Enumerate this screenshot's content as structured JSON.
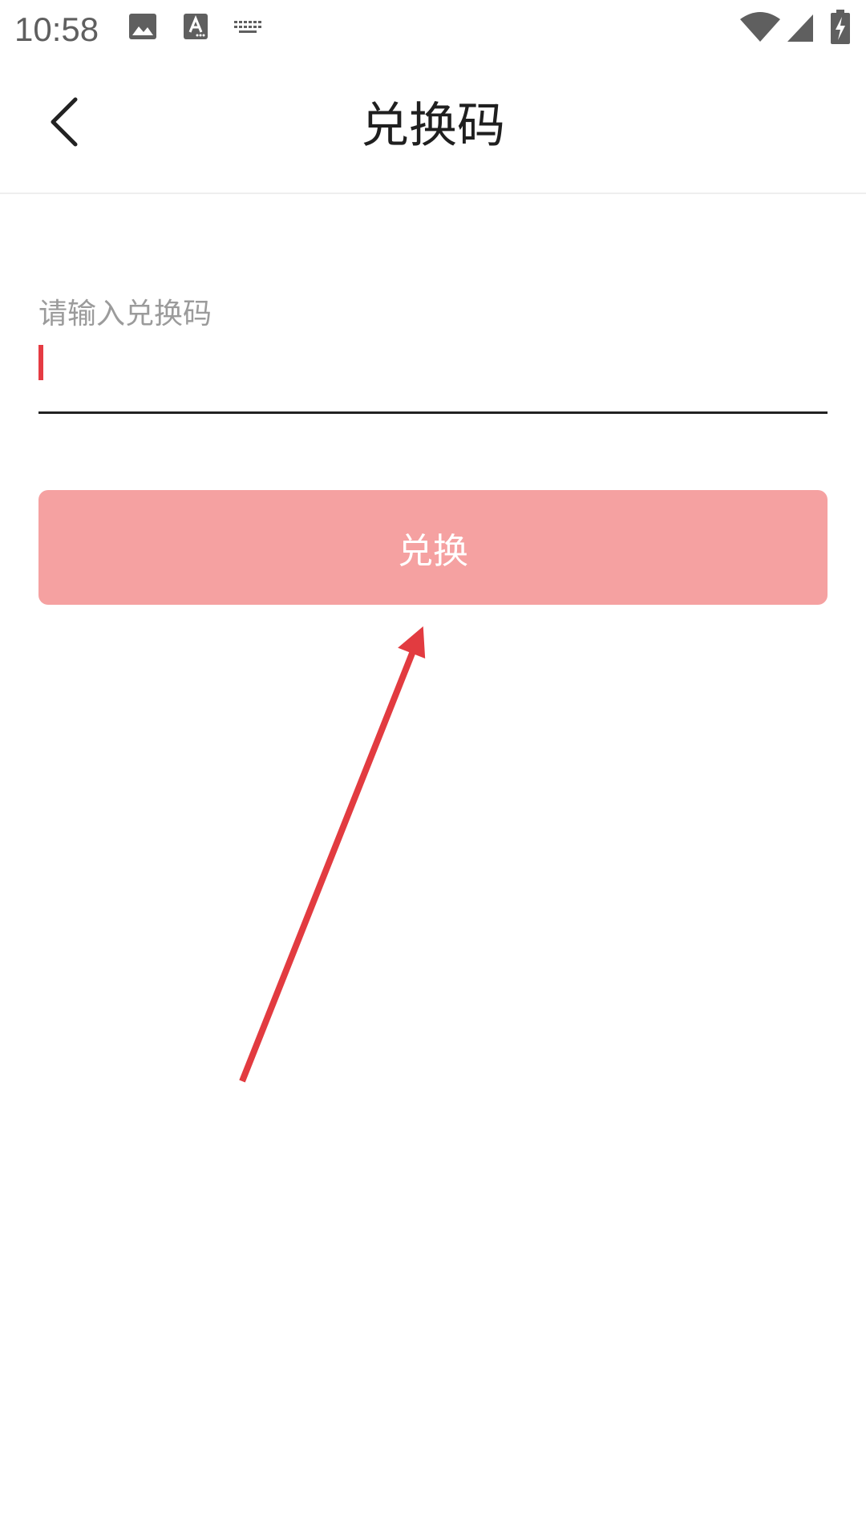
{
  "status_bar": {
    "time": "10:58",
    "icons": [
      "image-notification-icon",
      "a-notification-icon",
      "keyboard-icon",
      "wifi-icon",
      "cellular-signal-icon",
      "battery-charging-icon"
    ]
  },
  "app_bar": {
    "title": "兑换码",
    "back_icon": "chevron-left-icon"
  },
  "form": {
    "code_input": {
      "placeholder": "请输入兑换码",
      "value": ""
    },
    "redeem_button_label": "兑换"
  },
  "colors": {
    "accent": "#e53b43",
    "button_disabled": "#f5a1a1",
    "title_text": "#1f1f1f",
    "placeholder_text": "#9b9b9b"
  }
}
